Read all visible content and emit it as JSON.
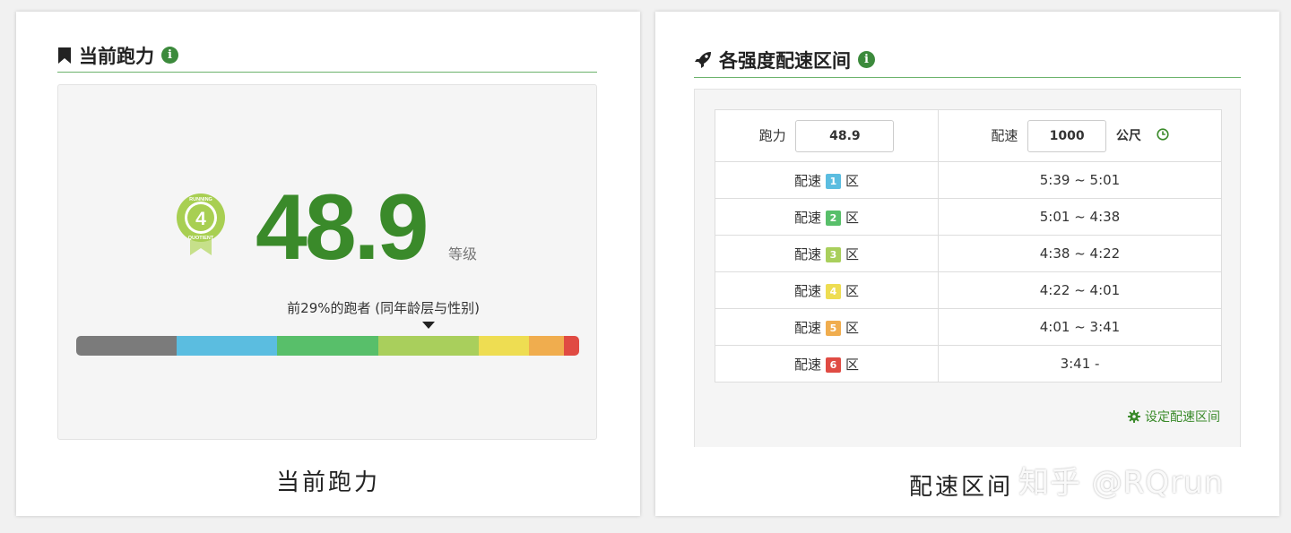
{
  "left_card": {
    "title": "当前跑力",
    "score": "48.9",
    "level_label": "等级",
    "badge": {
      "number": "4",
      "ring_top": "RUNNING",
      "ring_bottom": "QUOTIENT"
    },
    "percentile_text": "前29%的跑者 (同年龄层与性别)",
    "percentile_marker_fraction": 0.7,
    "scale_segments": [
      {
        "color": "#7b7b7b",
        "fraction": 0.2
      },
      {
        "color": "#5bbde0",
        "fraction": 0.2
      },
      {
        "color": "#58bf6a",
        "fraction": 0.2
      },
      {
        "color": "#a9cf5c",
        "fraction": 0.2
      },
      {
        "color": "#eedd52",
        "fraction": 0.1
      },
      {
        "color": "#f0ad4e",
        "fraction": 0.07
      },
      {
        "color": "#e04b43",
        "fraction": 0.03
      }
    ],
    "caption": "当前跑力"
  },
  "right_card": {
    "title": "各强度配速区间",
    "rq_label": "跑力",
    "rq_value": "48.9",
    "pace_label": "配速",
    "distance_value": "1000",
    "distance_unit": "公尺",
    "zone_prefix": "配速",
    "zone_suffix": "区",
    "zones": [
      {
        "num": "1",
        "color": "#5bbde0",
        "range": "5:39 ~ 5:01"
      },
      {
        "num": "2",
        "color": "#58bf6a",
        "range": "5:01 ~ 4:38"
      },
      {
        "num": "3",
        "color": "#a9cf5c",
        "range": "4:38 ~ 4:22"
      },
      {
        "num": "4",
        "color": "#eedd52",
        "range": "4:22 ~ 4:01"
      },
      {
        "num": "5",
        "color": "#f0ad4e",
        "range": "4:01 ~ 3:41"
      },
      {
        "num": "6",
        "color": "#e04b43",
        "range": "3:41 -"
      }
    ],
    "settings_link": "设定配速区间",
    "caption": "配速区间",
    "watermark": "知乎 @RQrun"
  },
  "colors": {
    "accent_green": "#3a8a2a",
    "header_rule": "#6cb36c"
  }
}
